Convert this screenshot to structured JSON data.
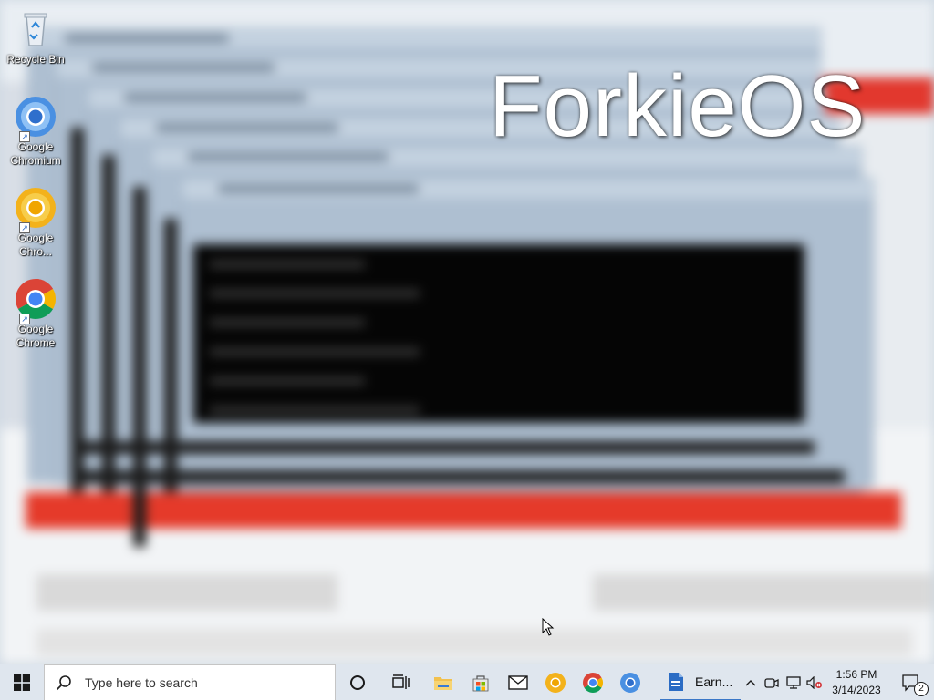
{
  "desktop": {
    "watermark": "ForkieOS",
    "icons": [
      {
        "label": "Recycle Bin",
        "icon": "recycle-bin-icon"
      },
      {
        "label": "Google Chromium",
        "icon": "chromium-icon"
      },
      {
        "label": "Google Chro...",
        "icon": "chrome-canary-icon"
      },
      {
        "label": "Google Chrome",
        "icon": "chrome-icon"
      }
    ]
  },
  "taskbar": {
    "start_icon": "windows-logo-icon",
    "search_placeholder": "Type here to search",
    "pinned": [
      {
        "name": "cortana",
        "icon": "circle-icon"
      },
      {
        "name": "task-view",
        "icon": "task-view-icon"
      },
      {
        "name": "file-explorer",
        "icon": "folder-icon"
      },
      {
        "name": "store",
        "icon": "store-icon"
      },
      {
        "name": "mail",
        "icon": "mail-icon"
      },
      {
        "name": "chrome-canary",
        "icon": "chrome-canary-icon"
      },
      {
        "name": "chrome",
        "icon": "chrome-icon"
      },
      {
        "name": "chromium",
        "icon": "chromium-icon"
      }
    ],
    "active_app_label": "Earn...",
    "tray": {
      "time": "1:56 PM",
      "date": "3/14/2023",
      "notification_count": "2"
    }
  },
  "colors": {
    "accent": "#3b78c8",
    "taskbar_bg": "#dfe6ee",
    "chrome_red": "#db4437",
    "chrome_green": "#0f9d58",
    "chrome_yellow": "#f4b400",
    "chrome_blue": "#4285f4"
  }
}
